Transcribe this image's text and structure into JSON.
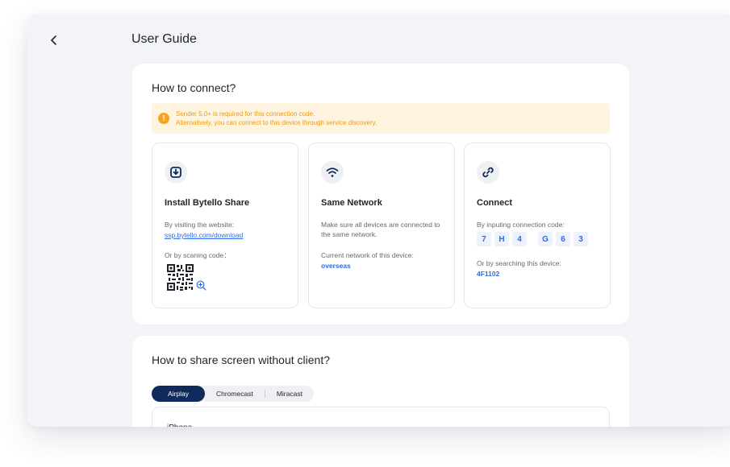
{
  "header": {
    "title": "User Guide",
    "back_icon": "chevron-left-icon"
  },
  "connect": {
    "title": "How to connect?",
    "notice": {
      "icon": "info-icon",
      "line1": "Sender 5.0+ is required for this connection code.",
      "line2": "Alternatively, you can connect to this device through service discovery."
    },
    "steps": [
      {
        "icon": "download-icon",
        "title": "Install Bytello Share",
        "text1": "By visiting the website:",
        "link": "ssp.bytello.com/download",
        "text2": "Or by scaning code："
      },
      {
        "icon": "wifi-icon",
        "title": "Same Network",
        "text1": "Make sure all devices are connected to the same network.",
        "text2": "Current network of this device:",
        "network": "overseas"
      },
      {
        "icon": "link-icon",
        "title": "Connect",
        "text1": "By inputing connection code:",
        "code": [
          "7",
          "H",
          "4",
          "G",
          "6",
          "3"
        ],
        "text2": "Or by searching this device:",
        "device": "4F1102"
      }
    ]
  },
  "share": {
    "title": "How to share screen without client?",
    "tabs": [
      "Airplay",
      "Chromecast",
      "Miracast"
    ],
    "active_tab": "Airplay",
    "sub_title": "iPhone"
  },
  "colors": {
    "accent": "#2f6bea",
    "notice_bg": "#fff4e0",
    "notice_text": "#e99b14",
    "active_tab": "#102a5c"
  }
}
